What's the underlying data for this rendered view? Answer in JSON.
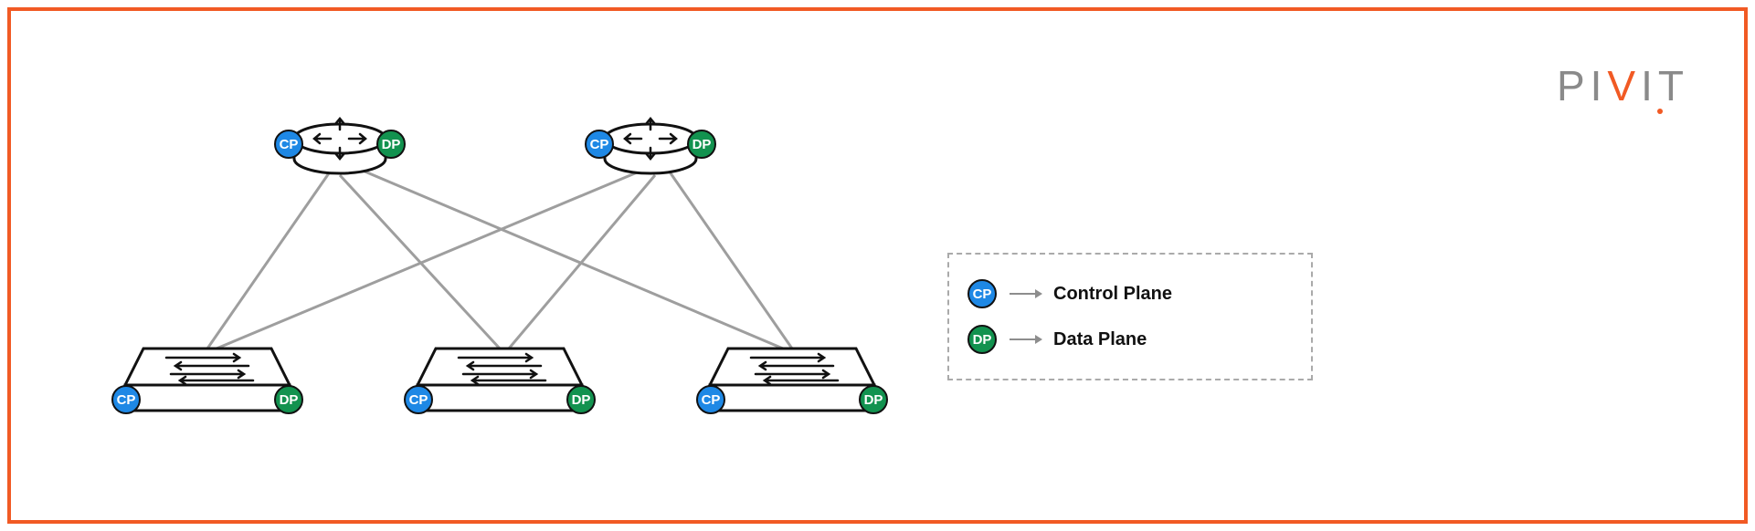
{
  "brand": {
    "p1": "PI",
    "v": "V",
    "p2": "IT"
  },
  "badges": {
    "cp": "CP",
    "dp": "DP"
  },
  "legend": {
    "cp_label": "Control Plane",
    "dp_label": "Data Plane"
  },
  "topology": {
    "routers": [
      {
        "id": "router-1",
        "cp": "CP",
        "dp": "DP"
      },
      {
        "id": "router-2",
        "cp": "CP",
        "dp": "DP"
      }
    ],
    "switches": [
      {
        "id": "switch-1",
        "cp": "CP",
        "dp": "DP"
      },
      {
        "id": "switch-2",
        "cp": "CP",
        "dp": "DP"
      },
      {
        "id": "switch-3",
        "cp": "CP",
        "dp": "DP"
      }
    ],
    "links": [
      [
        "router-1",
        "switch-1"
      ],
      [
        "router-1",
        "switch-2"
      ],
      [
        "router-1",
        "switch-3"
      ],
      [
        "router-2",
        "switch-1"
      ],
      [
        "router-2",
        "switch-2"
      ],
      [
        "router-2",
        "switch-3"
      ]
    ]
  }
}
